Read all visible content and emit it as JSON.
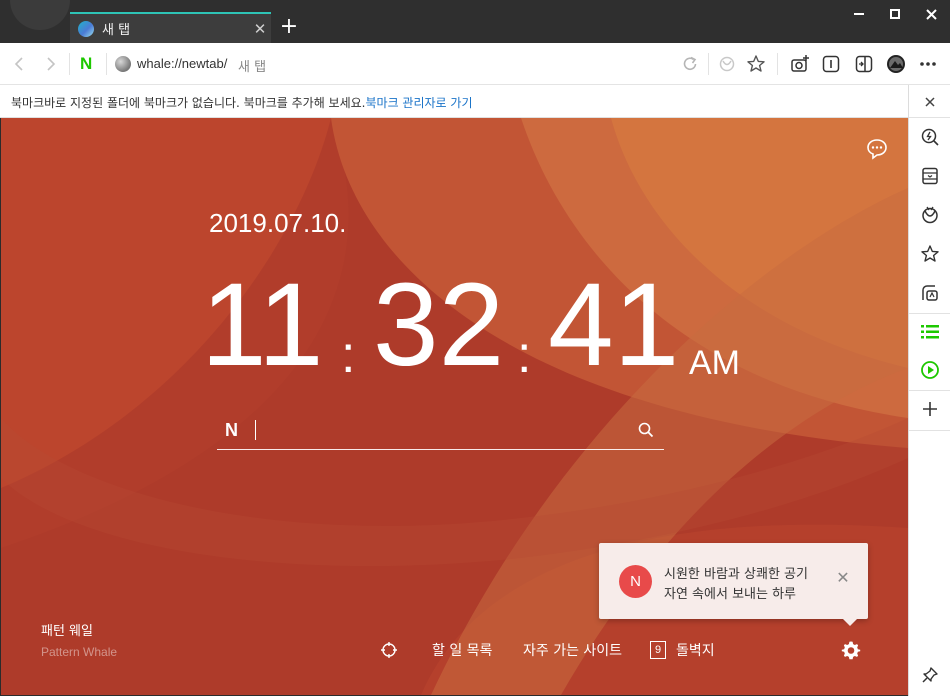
{
  "tab": {
    "title": "새 탭",
    "close": "✕",
    "new_tab": "+"
  },
  "window": {
    "minimize": "minimize",
    "maximize": "maximize",
    "close": "close"
  },
  "toolbar": {
    "brand": "N",
    "url": "whale://newtab/",
    "page_title": "새 탭"
  },
  "bookmark_bar": {
    "message": "북마크바로 지정된 폴더에 북마크가 없습니다. 북마크를 추가해 보세요.",
    "link": "북마크 관리자로 가기",
    "close": "✕"
  },
  "newtab": {
    "date": "2019.07.10.",
    "clock": {
      "hours": "11",
      "minutes": "32",
      "seconds": "41",
      "separator": ":",
      "ampm": "AM"
    },
    "search": {
      "brand": "N",
      "placeholder": ""
    },
    "pattern": {
      "name": "패턴 웨일",
      "subtitle": "Pattern Whale"
    },
    "bottom_nav": {
      "todo": "할 일 목록",
      "frequent_sites": "자주 가는 사이트",
      "wallpaper_count": "9",
      "wallpaper": "돌벽지"
    },
    "toast": {
      "badge": "N",
      "line1": "시원한 바람과 상쾌한 공기",
      "line2": "자연 속에서 보내는 하루",
      "close": "✕"
    }
  },
  "colors": {
    "accent": "#2ec4b6",
    "background": "#b8402c",
    "brand_green": "#1ec800",
    "sidebar_green": "#1ec800",
    "toast_badge": "#e84a4a"
  },
  "icons": {
    "toolbar": [
      "back-icon",
      "forward-icon",
      "reload-icon",
      "whale-mode-icon",
      "star-icon",
      "screenshot-icon",
      "reader-icon",
      "sidebar-toggle-icon",
      "profile-icon",
      "more-icon"
    ],
    "sidebar": [
      "quick-search-icon",
      "mobile-icon",
      "whale-icon",
      "bookmark-star-icon",
      "translate-icon",
      "list-icon",
      "play-icon",
      "add-icon",
      "pin-icon"
    ]
  }
}
